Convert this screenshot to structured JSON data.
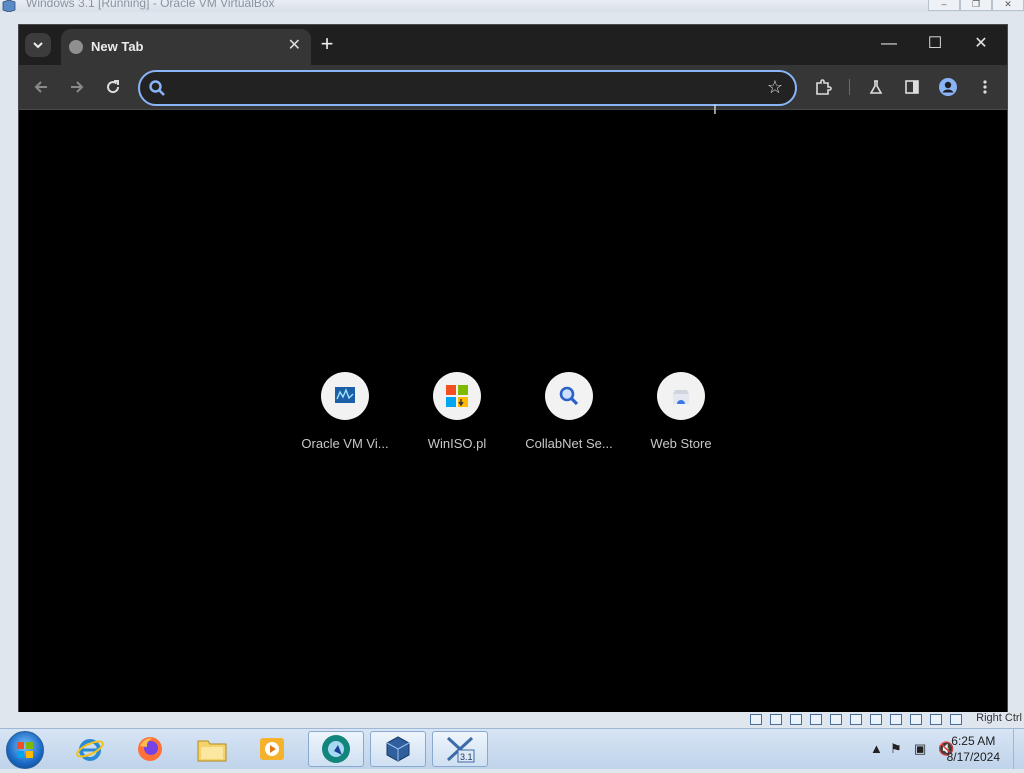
{
  "host_window": {
    "title": "Windows 3.1 [Running] - Oracle VM VirtualBox"
  },
  "browser": {
    "tab": {
      "title": "New Tab"
    },
    "omnibox": {
      "value": "",
      "placeholder": ""
    },
    "shortcuts": [
      {
        "label": "Oracle VM Vi...",
        "icon": "virtualbox-monitor-icon"
      },
      {
        "label": "WinISO.pl",
        "icon": "windows-logo-icon"
      },
      {
        "label": "CollabNet Se...",
        "icon": "magnifier-icon"
      },
      {
        "label": "Web Store",
        "icon": "web-store-icon"
      }
    ],
    "colors": {
      "accent": "#8ab4f8",
      "background": "#000000",
      "toolbar": "#363636",
      "tabstrip": "#1f1f1f"
    }
  },
  "vbox_status": {
    "host_key": "Right Ctrl"
  },
  "taskbar": {
    "apps": [
      {
        "name": "internet-explorer"
      },
      {
        "name": "firefox"
      },
      {
        "name": "file-explorer"
      },
      {
        "name": "media-player"
      },
      {
        "name": "chromium"
      },
      {
        "name": "virtualbox"
      },
      {
        "name": "windows-3-1-vm"
      }
    ],
    "clock": {
      "time": "6:25 AM",
      "date": "8/17/2024"
    }
  }
}
